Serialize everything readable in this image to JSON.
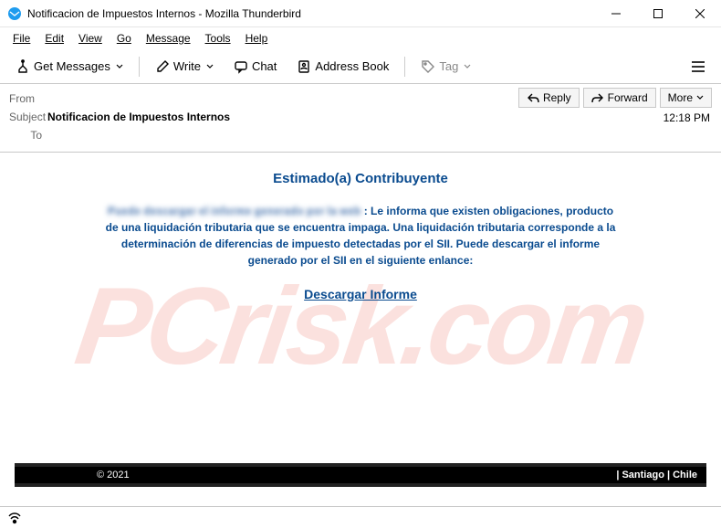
{
  "window": {
    "title": "Notificacion de Impuestos Internos - Mozilla Thunderbird"
  },
  "menu": {
    "file": "File",
    "edit": "Edit",
    "view": "View",
    "go": "Go",
    "message": "Message",
    "tools": "Tools",
    "help": "Help"
  },
  "toolbar": {
    "get_messages": "Get Messages",
    "write": "Write",
    "chat": "Chat",
    "address_book": "Address Book",
    "tag": "Tag"
  },
  "header": {
    "labels": {
      "from": "From",
      "subject": "Subject",
      "to": "To"
    },
    "subject": "Notificacion de Impuestos Internos",
    "time": "12:18 PM",
    "actions": {
      "reply": "Reply",
      "forward": "Forward",
      "more": "More"
    }
  },
  "body": {
    "heading": "Estimado(a) Contribuyente",
    "blurred_lead": "Puede descargar el informe generado por la web",
    "paragraph": " : Le informa que existen obligaciones, producto de una liquidación tributaria que se encuentra impaga. Una liquidación tributaria corresponde a la determinación de diferencias de impuesto detectadas por el SII.  Puede descargar el informe generado por el SII en el siguiente enlance:",
    "link": "Descargar Informe"
  },
  "footer": {
    "copyright": "© 2021",
    "location": "| Santiago | Chile"
  },
  "watermark": "PCrisk.com"
}
